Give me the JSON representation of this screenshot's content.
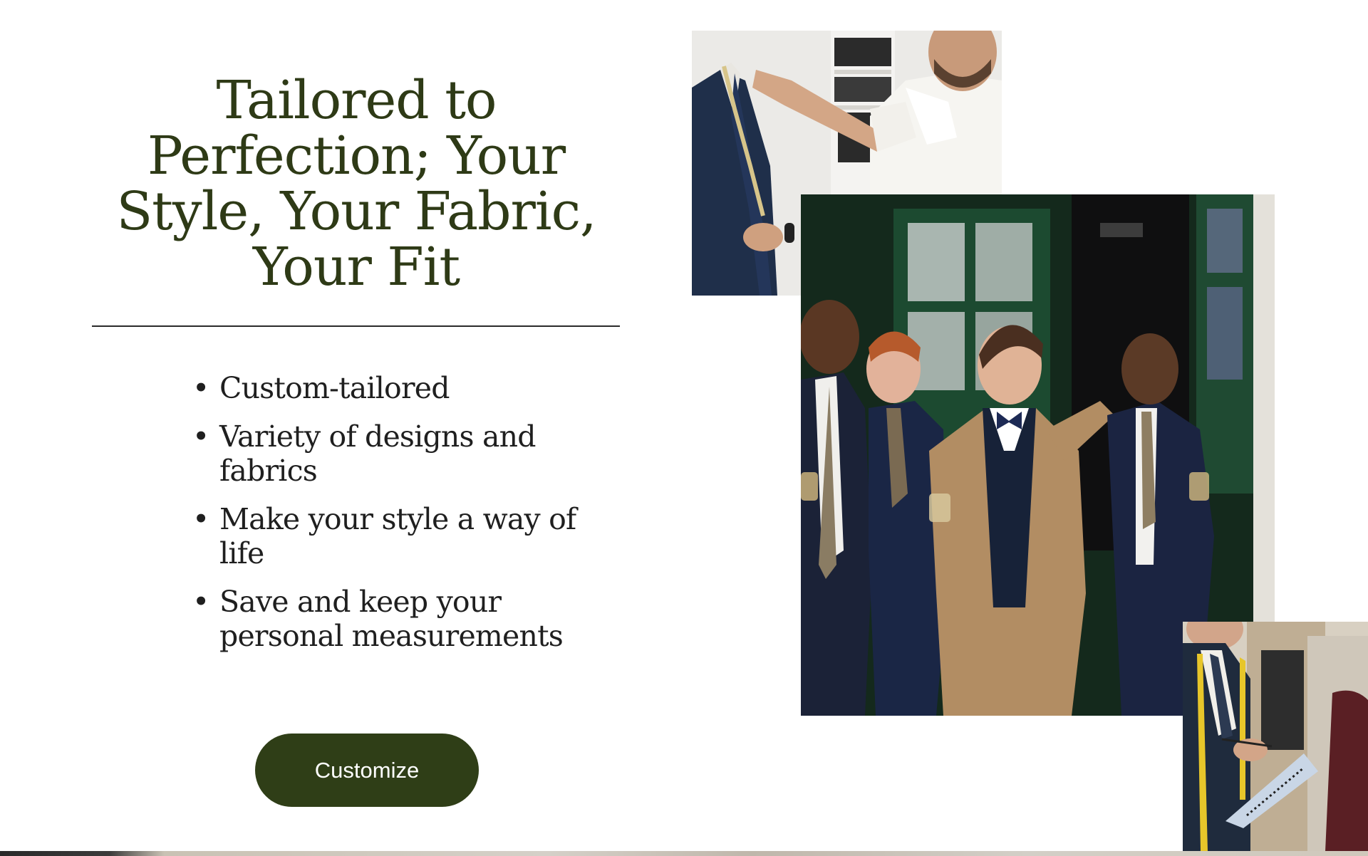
{
  "hero": {
    "title": "Tailored to Perfection; Your Style, Your Fabric, Your Fit",
    "features": [
      "Custom-tailored",
      "Variety of designs and fabrics",
      "Make your style a way of life",
      "Save and keep your personal measurements"
    ],
    "bullet": "•",
    "cta_label": "Customize"
  },
  "colors": {
    "heading": "#2e3a16",
    "button": "#2f3e17",
    "button_text": "#ffffff",
    "body_text": "#1f1f1f"
  },
  "images": [
    {
      "name": "tailor-measuring-photo"
    },
    {
      "name": "groom-with-friends-photo"
    },
    {
      "name": "tailor-taking-notes-photo"
    }
  ]
}
